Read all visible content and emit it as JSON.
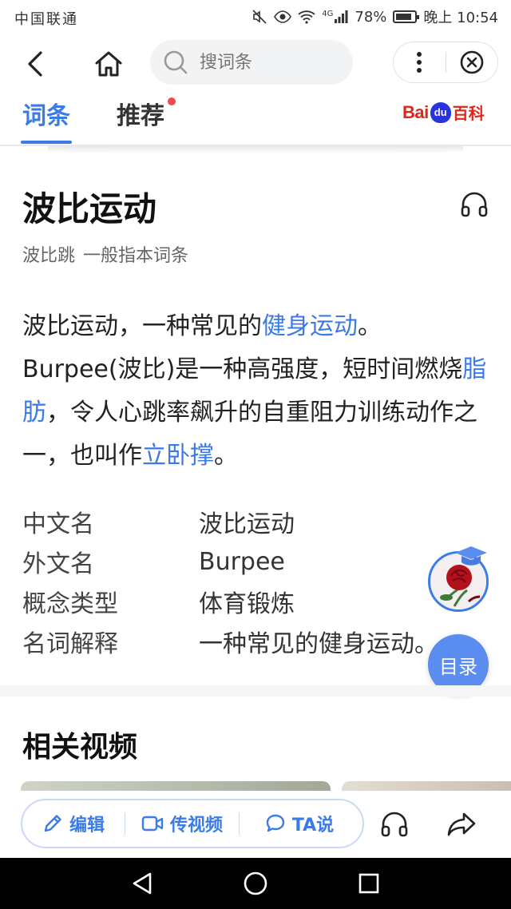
{
  "status_bar": {
    "carrier": "中国联通",
    "battery_percent": "78%",
    "time": "晚上 10:54",
    "network": "4G"
  },
  "nav": {
    "search_placeholder": "搜词条"
  },
  "tabs": [
    {
      "label": "词条",
      "active": true
    },
    {
      "label": "推荐",
      "active": false,
      "has_badge": true
    }
  ],
  "logo": {
    "bai": "Bai",
    "du": "du",
    "baike": "百科"
  },
  "entry": {
    "title": "波比运动",
    "subtitle_word": "波比跳",
    "subtitle_note": "一般指本词条",
    "paragraph": [
      {
        "text": "波比运动，一种常见的",
        "link": false
      },
      {
        "text": "健身运动",
        "link": true
      },
      {
        "text": "。Burpee(波比)是一种高强度，短时间燃烧",
        "link": false
      },
      {
        "text": "脂肪",
        "link": true
      },
      {
        "text": "，令人心跳率飙升的自重阻力训练动作之一，也叫作",
        "link": false
      },
      {
        "text": "立卧撑",
        "link": true
      },
      {
        "text": "。",
        "link": false
      }
    ],
    "info": [
      {
        "key": "中文名",
        "value": "波比运动"
      },
      {
        "key": "外文名",
        "value": "Burpee"
      },
      {
        "key": "概念类型",
        "value": "体育锻炼"
      },
      {
        "key": "名词解释",
        "value": "一种常见的健身运动。"
      }
    ]
  },
  "toc_label": "目录",
  "section": {
    "title": "相关视频"
  },
  "actions": {
    "edit": "编辑",
    "upload_video": "传视频",
    "ta_say": "TA说"
  },
  "colors": {
    "accent": "#3a7be8",
    "link": "#3a7be8",
    "badge": "#f04a4a",
    "logo_red": "#e1251b",
    "logo_blue": "#2932e1"
  }
}
